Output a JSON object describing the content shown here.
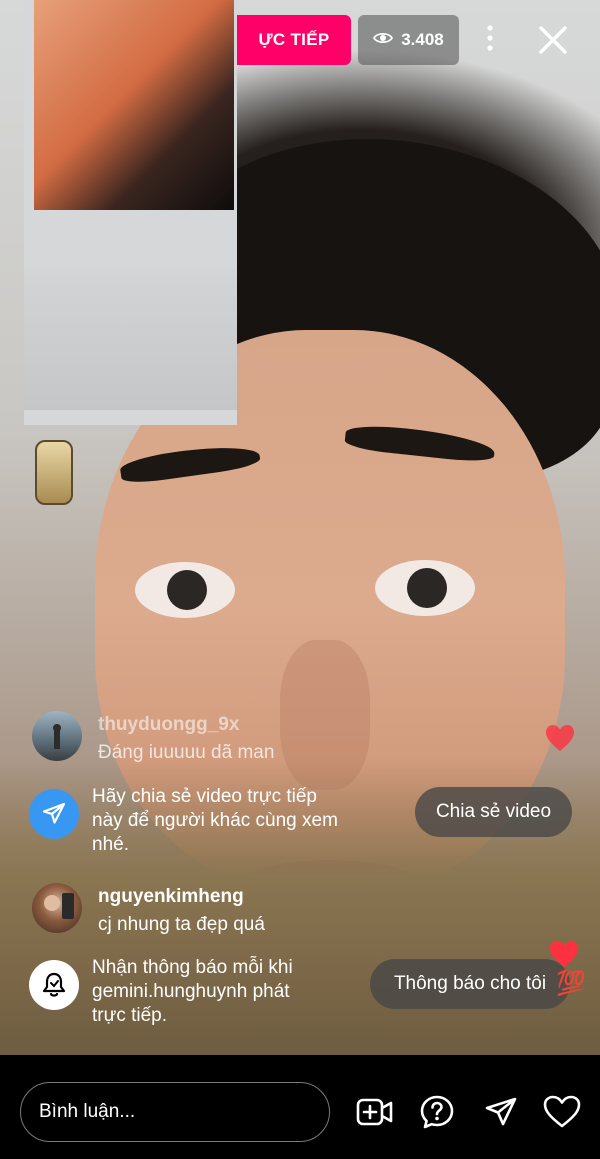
{
  "live": {
    "badge_label": "ỰC TIẾP",
    "viewer_count": "3.408"
  },
  "comments": [
    {
      "username": "thuyduongg_9x",
      "text": "Đáng iuuuuu dã man"
    },
    {
      "username": "nguyenkimheng",
      "text": "cj nhung ta đẹp quá"
    }
  ],
  "share_prompt": {
    "text_line1": "Hãy chia sẻ video trực tiếp",
    "text_line2": "này để người khác cùng xem",
    "text_line3": "nhé.",
    "button_label": "Chia sẻ video"
  },
  "notify_prompt": {
    "text_line1": "Nhận thông báo mỗi khi",
    "text_line2": "gemini.hunghuynh phát",
    "text_line3": "trực tiếp.",
    "button_label": "Thông báo cho tôi",
    "emoji": "💯"
  },
  "bottom_bar": {
    "comment_placeholder": "Bình luận..."
  },
  "colors": {
    "live_pink": "#ff0069",
    "share_blue": "#3897f0",
    "heart_red": "#ff3040"
  },
  "icons": [
    "eye-icon",
    "more-icon",
    "close-icon",
    "send-icon",
    "bell-icon",
    "heart-icon",
    "add-video-icon",
    "question-icon",
    "share-icon"
  ]
}
